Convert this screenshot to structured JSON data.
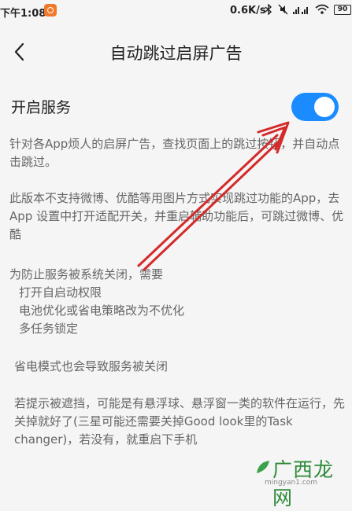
{
  "status_bar": {
    "time": "下午1:08",
    "speed": "0.6K/s",
    "battery": "90"
  },
  "header": {
    "title": "自动跳过启屏广告"
  },
  "service": {
    "label": "开启服务",
    "enabled": true
  },
  "description": {
    "p1": "针对各App烦人的启屏广告，查找页面上的跳过按钮，并自动点击跳过。",
    "p2": "此版本不支持微博、优酷等用图片方式实现跳过功能的App，去App 设置中打开适配开关，并重启辅助功能后，可跳过微博、优酷",
    "p3_intro": "为防止服务被系统关闭，需要",
    "p3_items": [
      "打开自启动权限",
      "电池优化或省电策略改为不优化",
      "多任务锁定"
    ],
    "p4": "省电模式也会导致服务被关闭",
    "p5": "若提示被遮挡，可能是有悬浮球、悬浮窗一类的软件在运行，先关掉就好了(三星可能还需要关掉Good look里的Task changer)，若没有，就重启下手机"
  },
  "watermark": {
    "text": "广西龙网",
    "url": "mingyan1.com"
  },
  "colors": {
    "toggle_on": "#1a8cff",
    "arrow": "#d42a2a"
  },
  "icons": {
    "back": "chevron-left-icon",
    "app": "app-notification-icon"
  }
}
